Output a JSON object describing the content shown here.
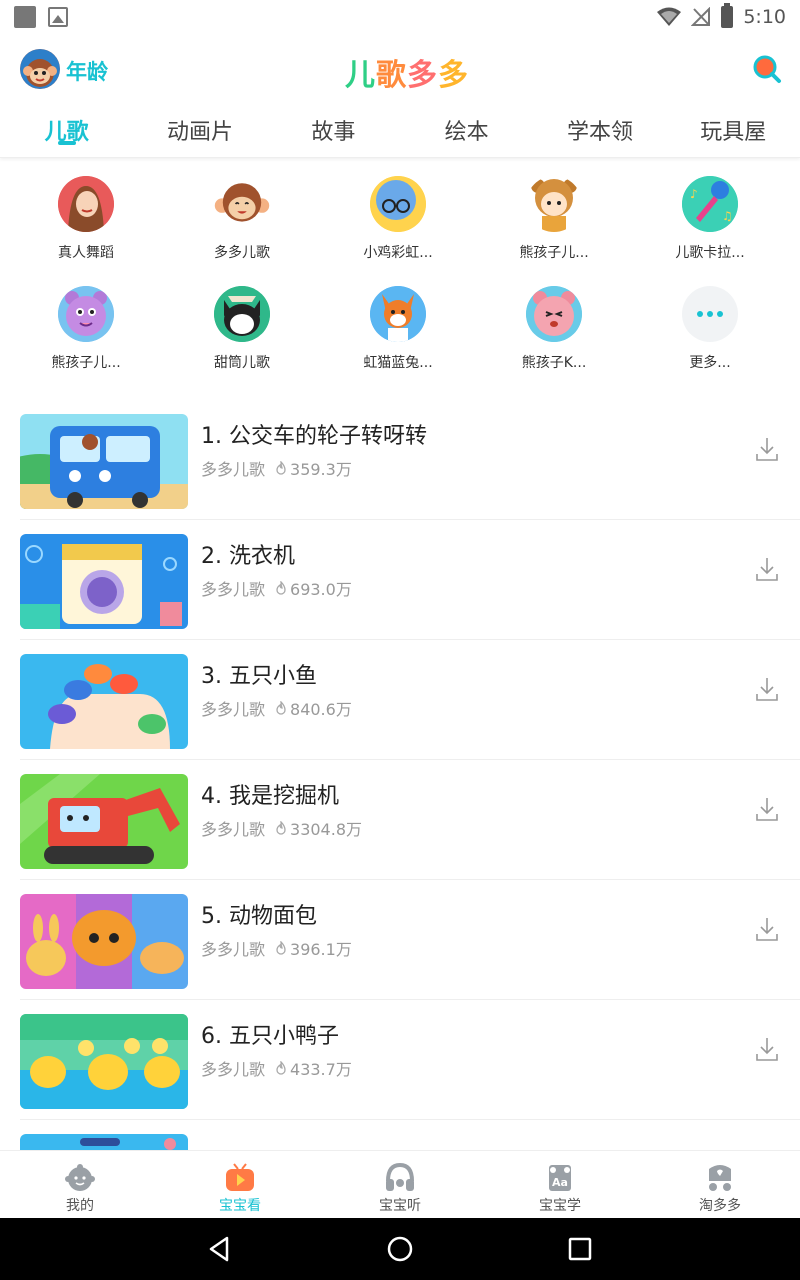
{
  "status_bar": {
    "time": "5:10"
  },
  "header": {
    "age_label": "年龄",
    "logo_chars": [
      "儿",
      "歌",
      "多",
      "多"
    ]
  },
  "tabs": [
    {
      "label": "儿歌",
      "active": true
    },
    {
      "label": "动画片",
      "active": false
    },
    {
      "label": "故事",
      "active": false
    },
    {
      "label": "绘本",
      "active": false
    },
    {
      "label": "学本领",
      "active": false
    },
    {
      "label": "玩具屋",
      "active": false
    }
  ],
  "categories": [
    {
      "label": "真人舞蹈",
      "icon": "girl-dancer-icon"
    },
    {
      "label": "多多儿歌",
      "icon": "monkey-icon"
    },
    {
      "label": "小鸡彩虹...",
      "icon": "chick-icon"
    },
    {
      "label": "熊孩子儿...",
      "icon": "bear-kid-icon"
    },
    {
      "label": "儿歌卡拉...",
      "icon": "microphone-icon"
    },
    {
      "label": "熊孩子儿...",
      "icon": "purple-bear-icon"
    },
    {
      "label": "甜筒儿歌",
      "icon": "cat-icon"
    },
    {
      "label": "虹猫蓝兔...",
      "icon": "fox-icon"
    },
    {
      "label": "熊孩子K...",
      "icon": "pink-bear-icon"
    },
    {
      "label": "更多...",
      "icon": "more-dots-icon"
    }
  ],
  "songs": [
    {
      "title": "1. 公交车的轮子转呀转",
      "channel": "多多儿歌",
      "plays": "359.3万"
    },
    {
      "title": "2. 洗衣机",
      "channel": "多多儿歌",
      "plays": "693.0万"
    },
    {
      "title": "3. 五只小鱼",
      "channel": "多多儿歌",
      "plays": "840.6万"
    },
    {
      "title": "4. 我是挖掘机",
      "channel": "多多儿歌",
      "plays": "3304.8万"
    },
    {
      "title": "5. 动物面包",
      "channel": "多多儿歌",
      "plays": "396.1万"
    },
    {
      "title": "6. 五只小鸭子",
      "channel": "多多儿歌",
      "plays": "433.7万"
    }
  ],
  "bottom_nav": [
    {
      "label": "我的",
      "icon": "baby-face-icon",
      "active": false
    },
    {
      "label": "宝宝看",
      "icon": "tv-play-icon",
      "active": true
    },
    {
      "label": "宝宝听",
      "icon": "headphones-icon",
      "active": false
    },
    {
      "label": "宝宝学",
      "icon": "aa-book-icon",
      "active": false
    },
    {
      "label": "淘多多",
      "icon": "stroller-icon",
      "active": false
    }
  ],
  "colors": {
    "accent": "#19c2d2",
    "active_nav": "#ff7a45",
    "text_primary": "#222222",
    "text_secondary": "#999999"
  }
}
